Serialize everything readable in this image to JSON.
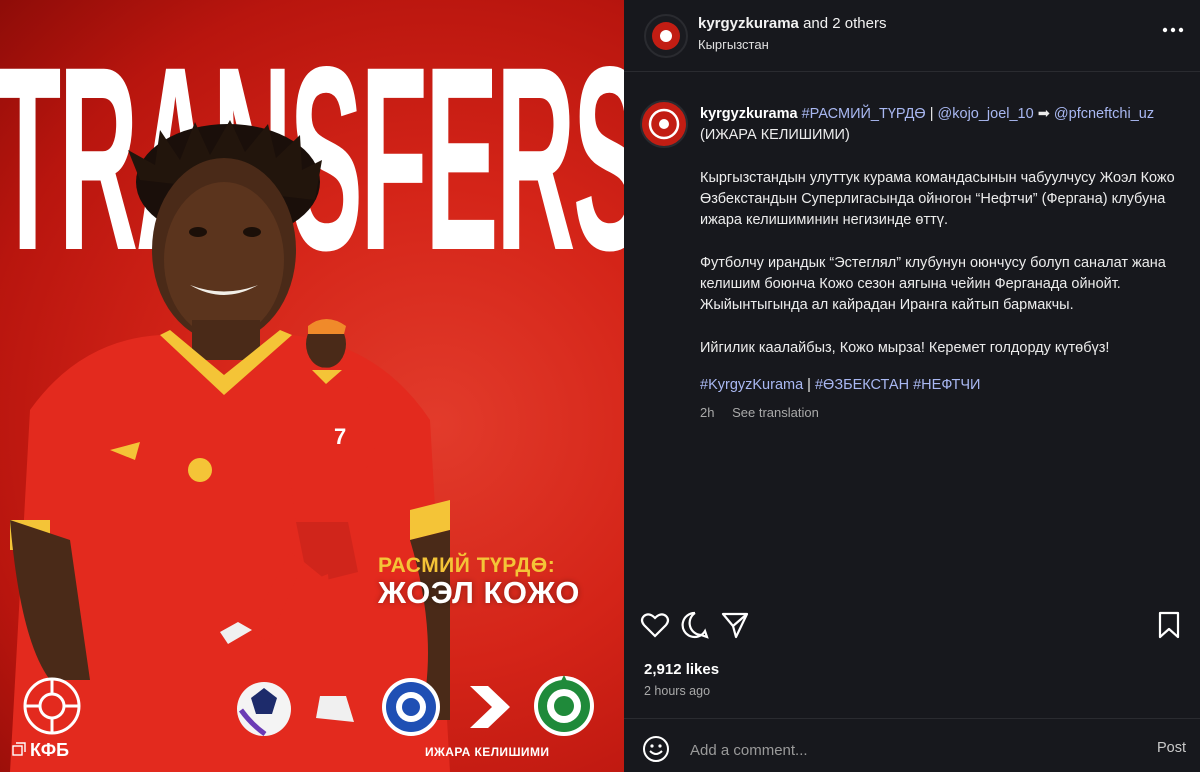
{
  "media": {
    "headline": "TRANSFERS",
    "promo_line1": "РАСМИЙ ТҮРДӨ:",
    "promo_line2": "ЖОЭЛ КОЖО",
    "loan_caption": "ИЖАРА КЕЛИШИМИ",
    "logo_text": "КФБ",
    "jersey_number": "7"
  },
  "header": {
    "username": "kyrgyzkurama",
    "collab_text": " and 2 others",
    "location": "Кыргызстан"
  },
  "caption": {
    "username": "kyrgyzkurama",
    "tag1": "#РАСМИЙ_ТҮРДӨ",
    "sep1": " | ",
    "mention1": "@kojo_joel_10",
    "arrow": " ➡",
    "mention2": "@pfcneftchi_uz",
    "line1_rest": " (ИЖАРА КЕЛИШИМИ)",
    "para1": "Кыргызстандын улуттук курама командасынын чабуулчусу Жоэл Кожо Өзбекстандын Суперлигасында ойногон “Нефтчи” (Фергана) клубуна ижара келишиминин негизинде өттү.",
    "para2": "Футболчу ирандык “Эстеглял” клубунун оюнчусу болуп саналат жана келишим боюнча Кожо сезон аягына чейин Ферганада ойнойт. Жыйынтыгында ал кайрадан Иранга кайтып бармакчы.",
    "para3": "Ийгилик каалайбыз, Кожо мырза! Керемет голдорду күтөбүз!",
    "hashtag1": "#KyrgyzKurama",
    "hashtag_sep": " | ",
    "hashtag2": "#ӨЗБЕКСТАН",
    "hashtag3": "#НЕФТЧИ",
    "age": "2h",
    "see_translation": "See translation"
  },
  "stats": {
    "likes": "2,912 likes",
    "time": "2 hours ago"
  },
  "comment": {
    "placeholder": "Add a comment...",
    "post_label": "Post"
  },
  "colors": {
    "panel_bg": "#17181d",
    "accent_red": "#d42418",
    "link": "#a9b8f2",
    "gold": "#f4c437"
  },
  "icons": [
    "heart-icon",
    "comment-icon",
    "share-icon",
    "bookmark-icon",
    "more-icon",
    "emoji-icon",
    "carousel-icon"
  ]
}
